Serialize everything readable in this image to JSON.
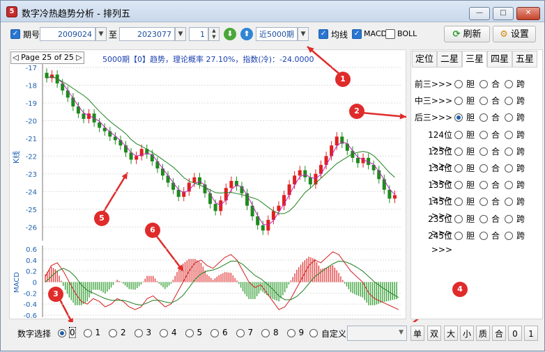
{
  "app_title": "数字冷热趋势分析 - 排列五",
  "app_icon_glyph": "5",
  "window_buttons": {
    "minimize": "—",
    "maximize": "□",
    "close": "✕"
  },
  "toolbar": {
    "issue_label": "期号",
    "issue_from": "2009024",
    "to_label": "至",
    "issue_to": "2023077",
    "step_value": "1",
    "range_select": "近5000期",
    "ma_label": "均线",
    "macd_label": "MACD",
    "boll_label": "BOLL",
    "refresh_label": "刷新",
    "settings_label": "设置"
  },
  "chart_header": {
    "page_label": "Page 25 of 25",
    "info": "5000期【0】趋势，理论概率 27.10%，指数(冷)：-24.0000"
  },
  "tabs": [
    "定位",
    "二星",
    "三星",
    "四星",
    "五星"
  ],
  "active_tab": "三星",
  "positions": [
    {
      "label": "前三>>>",
      "selected": false
    },
    {
      "label": "中三>>>",
      "selected": false
    },
    {
      "label": "后三>>>",
      "selected": true
    },
    {
      "label": "124位>>>",
      "selected": false
    },
    {
      "label": "125位>>>",
      "selected": false
    },
    {
      "label": "134位>>>",
      "selected": false
    },
    {
      "label": "135位>>>",
      "selected": false
    },
    {
      "label": "145位>>>",
      "selected": false
    },
    {
      "label": "235位>>>",
      "selected": false
    },
    {
      "label": "245位>>>",
      "selected": false
    }
  ],
  "option_labels": [
    "胆",
    "合",
    "跨"
  ],
  "bottom": {
    "digit_select_label": "数字选择",
    "digits": [
      "0",
      "1",
      "2",
      "3",
      "4",
      "5",
      "6",
      "7",
      "8",
      "9"
    ],
    "selected_digit": "0",
    "custom_label": "自定义",
    "quick_buttons": [
      "单",
      "双",
      "大",
      "小",
      "质",
      "合",
      "0",
      "1"
    ]
  },
  "annotations": [
    "1",
    "2",
    "3",
    "4",
    "5",
    "6"
  ],
  "chart_data": [
    {
      "type": "candlestick",
      "ylabel": "K线",
      "ylim": [
        -26.5,
        -17
      ],
      "yticks": [
        -17,
        -18,
        -19,
        -20,
        -21,
        -22,
        -23,
        -24,
        -25,
        -26
      ],
      "series": [
        {
          "name": "MA-short",
          "color": "#c020c0"
        },
        {
          "name": "MA-long",
          "color": "#208020"
        }
      ],
      "close": [
        -17.6,
        -17.4,
        -17.9,
        -18.3,
        -18.7,
        -19.2,
        -19.6,
        -19.9,
        -19.6,
        -20.1,
        -20.4,
        -20.6,
        -20.9,
        -21.1,
        -21.4,
        -21.8,
        -22.2,
        -22.0,
        -21.6,
        -21.9,
        -22.3,
        -22.7,
        -23.1,
        -23.5,
        -23.9,
        -24.3,
        -24.0,
        -23.5,
        -23.2,
        -23.6,
        -24.1,
        -24.7,
        -25.1,
        -24.5,
        -23.8,
        -23.4,
        -23.7,
        -24.1,
        -24.8,
        -25.4,
        -25.9,
        -26.2,
        -25.6,
        -25.1,
        -24.8,
        -24.2,
        -23.6,
        -23.1,
        -22.8,
        -23.2,
        -23.6,
        -23.0,
        -22.5,
        -22.0,
        -21.4,
        -20.9,
        -21.3,
        -21.7,
        -22.1,
        -22.4,
        -22.1,
        -22.5,
        -22.8,
        -23.3,
        -23.9,
        -24.4,
        -24.2
      ]
    },
    {
      "type": "macd",
      "ylabel": "MACD",
      "ylim": [
        -0.6,
        0.6
      ],
      "yticks": [
        0.6,
        0.4,
        0.2,
        0,
        -0.2,
        -0.4,
        -0.6
      ],
      "series": [
        {
          "name": "DIF",
          "color": "#d02020"
        },
        {
          "name": "DEA",
          "color": "#208020"
        }
      ],
      "dif": [
        0.1,
        0.3,
        0.35,
        0.2,
        0.0,
        -0.2,
        -0.35,
        -0.4,
        -0.3,
        -0.35,
        -0.45,
        -0.4,
        -0.3,
        -0.35,
        -0.45,
        -0.5,
        -0.45,
        -0.3,
        -0.25,
        -0.35,
        -0.45,
        -0.4,
        -0.2,
        0.0,
        0.2,
        0.35,
        0.4,
        0.3,
        0.25,
        0.35,
        0.45,
        0.5,
        0.4,
        0.2,
        0.0,
        -0.1,
        -0.05,
        -0.2,
        -0.35,
        -0.5,
        -0.45,
        -0.3,
        -0.1,
        0.1,
        0.3,
        0.4,
        0.35,
        0.45,
        0.55,
        0.5,
        0.35,
        0.2,
        0.1,
        0.0,
        -0.2,
        -0.3,
        -0.35,
        -0.4,
        -0.45,
        -0.5
      ],
      "dea": [
        0.0,
        0.1,
        0.2,
        0.25,
        0.2,
        0.1,
        -0.05,
        -0.15,
        -0.2,
        -0.25,
        -0.3,
        -0.33,
        -0.33,
        -0.33,
        -0.36,
        -0.4,
        -0.42,
        -0.38,
        -0.33,
        -0.33,
        -0.36,
        -0.38,
        -0.33,
        -0.24,
        -0.1,
        0.05,
        0.15,
        0.2,
        0.22,
        0.26,
        0.32,
        0.38,
        0.38,
        0.32,
        0.22,
        0.12,
        0.06,
        -0.03,
        -0.13,
        -0.25,
        -0.32,
        -0.32,
        -0.26,
        -0.16,
        -0.03,
        0.1,
        0.18,
        0.26,
        0.33,
        0.38,
        0.37,
        0.33,
        0.27,
        0.2,
        0.1,
        0.0,
        -0.08,
        -0.15,
        -0.22,
        -0.28
      ]
    }
  ]
}
